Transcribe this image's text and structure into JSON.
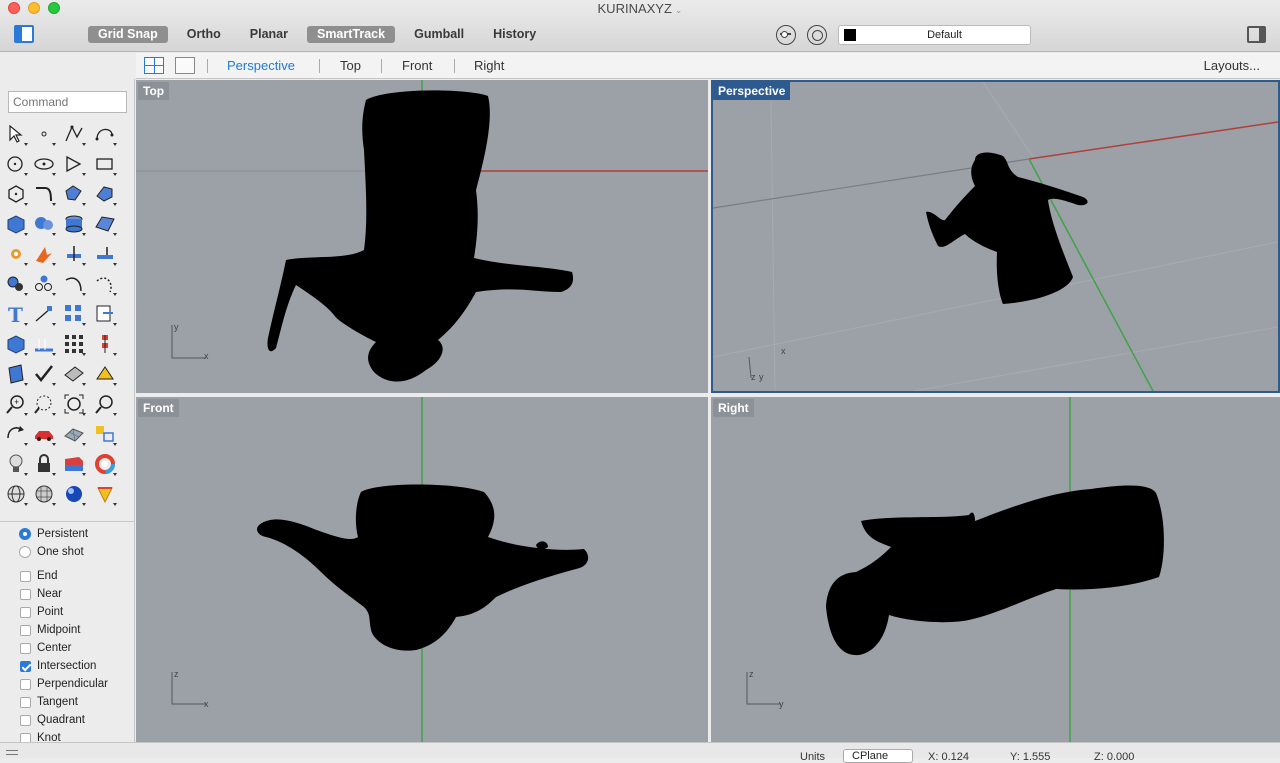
{
  "window": {
    "title": "KURINAXYZ"
  },
  "toolbar": {
    "toggles": [
      {
        "label": "Grid Snap",
        "active": true
      },
      {
        "label": "Ortho",
        "active": false
      },
      {
        "label": "Planar",
        "active": false
      },
      {
        "label": "SmartTrack",
        "active": true
      },
      {
        "label": "Gumball",
        "active": false
      },
      {
        "label": "History",
        "active": false
      }
    ],
    "layer": {
      "name": "Default",
      "color": "#000000"
    }
  },
  "viewport_tabs": {
    "tabs": [
      {
        "label": "Perspective",
        "active": true
      },
      {
        "label": "Top",
        "active": false
      },
      {
        "label": "Front",
        "active": false
      },
      {
        "label": "Right",
        "active": false
      }
    ],
    "layouts_label": "Layouts..."
  },
  "command": {
    "placeholder": "Command"
  },
  "tools": [
    "select-arrow",
    "point",
    "polyline",
    "curve",
    "circle",
    "ellipse",
    "polygon-curve",
    "rectangle",
    "polygon",
    "fillet-curves",
    "surface-from-points",
    "extrude-surface",
    "box",
    "sphere",
    "cylinder",
    "loft",
    "explode",
    "boolean-wedge",
    "trim",
    "split",
    "solid-tools",
    "group",
    "offset-curve",
    "blend",
    "text",
    "dimension",
    "array",
    "transform",
    "block",
    "hatch",
    "array-grid",
    "tolerance",
    "surface-analysis",
    "check",
    "plane",
    "paint-bucket",
    "zoom-in",
    "zoom-window",
    "zoom-extents",
    "zoom",
    "rotate-view",
    "car-render",
    "mesh",
    "snapshot",
    "light",
    "lock",
    "layer",
    "color-wheel",
    "render-sphere",
    "grid-sphere",
    "material-ball",
    "cone"
  ],
  "osnap": {
    "modes": [
      {
        "label": "Persistent",
        "selected": true
      },
      {
        "label": "One shot",
        "selected": false
      }
    ],
    "snaps": [
      {
        "label": "End",
        "checked": false
      },
      {
        "label": "Near",
        "checked": false
      },
      {
        "label": "Point",
        "checked": false
      },
      {
        "label": "Midpoint",
        "checked": false
      },
      {
        "label": "Center",
        "checked": false
      },
      {
        "label": "Intersection",
        "checked": true
      },
      {
        "label": "Perpendicular",
        "checked": false
      },
      {
        "label": "Tangent",
        "checked": false
      },
      {
        "label": "Quadrant",
        "checked": false
      },
      {
        "label": "Knot",
        "checked": false
      }
    ]
  },
  "viewports": [
    {
      "name": "Top",
      "active": false,
      "axis_labels": [
        "y",
        "x"
      ]
    },
    {
      "name": "Perspective",
      "active": true,
      "axis_labels": [
        "x",
        "z",
        "y"
      ]
    },
    {
      "name": "Front",
      "active": false,
      "axis_labels": [
        "z",
        "x"
      ]
    },
    {
      "name": "Right",
      "active": false,
      "axis_labels": [
        "z",
        "y"
      ]
    }
  ],
  "status": {
    "units_label": "Units",
    "cplane": "CPlane",
    "x": "X: 0.124",
    "y": "Y: 1.555",
    "z": "Z: 0.000"
  },
  "colors": {
    "accent": "#2b7ad8",
    "viewport_bg": "#9ca0a7",
    "x_axis": "#b0403a",
    "y_axis": "#3fa348"
  }
}
